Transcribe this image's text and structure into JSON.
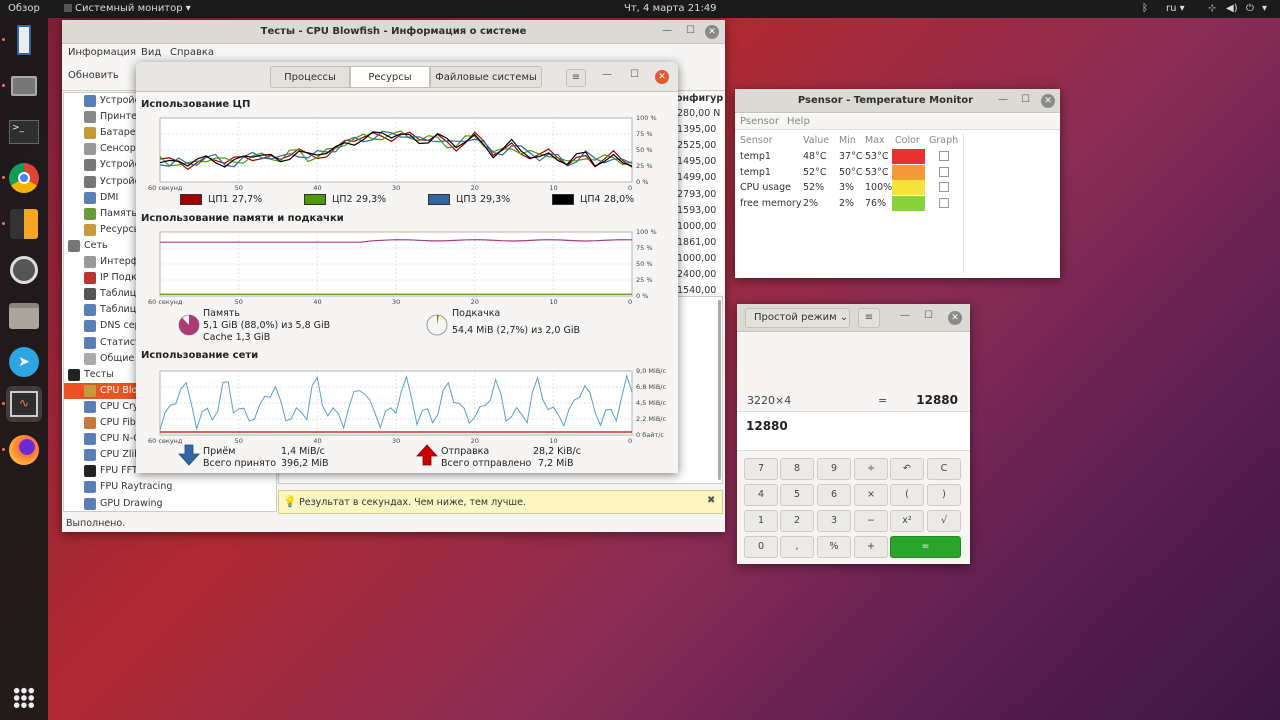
{
  "topbar": {
    "overview": "Обзор",
    "app_menu": "Системный монитор",
    "clock": "Чт, 4 марта  21:49",
    "lang": "ru"
  },
  "hardinfo": {
    "title": "Тесты - CPU Blowfish - Информация о системе",
    "menu": [
      "Информация",
      "Вид",
      "Справка"
    ],
    "refresh": "Обновить",
    "column_header": "онфигур",
    "values": [
      "280,00 N",
      "1395,00",
      "2525,00",
      "1495,00",
      "1499,00",
      "2793,00",
      "1593,00",
      "1000,00",
      "1861,00",
      "1000,00",
      "2400,00",
      "1540,00"
    ],
    "tree": [
      {
        "label": "Устройс",
        "color": "#5a7fb5",
        "indent": 1
      },
      {
        "label": "Принтер",
        "color": "#888",
        "indent": 1
      },
      {
        "label": "Батарея",
        "color": "#c49a3a",
        "indent": 1
      },
      {
        "label": "Сенсоры",
        "color": "#999",
        "indent": 1
      },
      {
        "label": "Устройс",
        "color": "#777",
        "indent": 1
      },
      {
        "label": "Устройс",
        "color": "#777",
        "indent": 1
      },
      {
        "label": "DMI",
        "color": "#5a7fb5",
        "indent": 1
      },
      {
        "label": "Память",
        "color": "#6a9a3a",
        "indent": 1
      },
      {
        "label": "Ресурсы",
        "color": "#c49a3a",
        "indent": 1
      },
      {
        "label": "Сеть",
        "color": "#777",
        "indent": 0
      },
      {
        "label": "Интерф",
        "color": "#999",
        "indent": 1
      },
      {
        "label": "IP Подк",
        "color": "#b33",
        "indent": 1
      },
      {
        "label": "Таблица",
        "color": "#555",
        "indent": 1
      },
      {
        "label": "Таблица",
        "color": "#5a7fb5",
        "indent": 1
      },
      {
        "label": "DNS сер",
        "color": "#5a7fb5",
        "indent": 1
      },
      {
        "label": "Статист",
        "color": "#5a7fb5",
        "indent": 1
      },
      {
        "label": "Общие п",
        "color": "#aaa",
        "indent": 1
      },
      {
        "label": "Тесты",
        "color": "#222",
        "indent": 0
      },
      {
        "label": "CPU Blow",
        "color": "#c49a3a",
        "indent": 1,
        "selected": true
      },
      {
        "label": "CPU Cry",
        "color": "#5a7fb5",
        "indent": 1
      },
      {
        "label": "CPU Fibo",
        "color": "#c47a3a",
        "indent": 1
      },
      {
        "label": "CPU N-Q",
        "color": "#5a7fb5",
        "indent": 1
      },
      {
        "label": "CPU Zlib",
        "color": "#5a7fb5",
        "indent": 1
      },
      {
        "label": "FPU FFT",
        "color": "#222",
        "indent": 1
      },
      {
        "label": "FPU Raytracing",
        "color": "#5a7fb5",
        "indent": 1
      },
      {
        "label": "GPU Drawing",
        "color": "#5a7fb5",
        "indent": 1
      }
    ],
    "hint": "Результат в секундах. Чем ниже, тем лучше.",
    "status": "Выполнено."
  },
  "sysmon": {
    "tabs": [
      "Процессы",
      "Ресурсы",
      "Файловые системы"
    ],
    "cpu_title": "Использование ЦП",
    "mem_title": "Использование памяти и подкачки",
    "net_title": "Использование сети",
    "x_ticks": [
      "60 секунд",
      "50",
      "40",
      "30",
      "20",
      "10",
      "0"
    ],
    "pct_ticks": [
      "100 %",
      "75 %",
      "50 %",
      "25 %",
      "0 %"
    ],
    "net_ticks": [
      "9,0 MiB/c",
      "6,8 MiB/c",
      "4,5 MiB/c",
      "2,2 MiB/c",
      "0 байт/с"
    ],
    "cpu_legend": [
      {
        "label": "ЦП1",
        "value": "27,7%",
        "color": "#a40000"
      },
      {
        "label": "ЦП2",
        "value": "29,3%",
        "color": "#4e9a06"
      },
      {
        "label": "ЦП3",
        "value": "29,3%",
        "color": "#3465a4"
      },
      {
        "label": "ЦП4",
        "value": "28,0%",
        "color": "#000000"
      }
    ],
    "memory": {
      "label": "Память",
      "line1": "5,1 GiB (88,0%) из 5,8 GiB",
      "line2": "Cache 1,3 GiB",
      "color": "#ad3c76",
      "fraction": 0.88
    },
    "swap": {
      "label": "Подкачка",
      "line1": "54,4 MiB (2,7%) из 2,0 GiB",
      "color": "#4e9a06",
      "fraction": 0.027
    },
    "net_rx": {
      "label": "Приём",
      "total_label": "Всего принято",
      "rate": "1,4 MiB/c",
      "total": "396,2 MiB",
      "color": "#3465a4"
    },
    "net_tx": {
      "label": "Отправка",
      "total_label": "Всего отправлено",
      "rate": "28,2 KiB/c",
      "total": "7,2 MiB",
      "color": "#cc0000"
    }
  },
  "psensor": {
    "title": "Psensor - Temperature Monitor",
    "menu": [
      "Psensor",
      "Help"
    ],
    "headers": [
      "Sensor",
      "Value",
      "Min",
      "Max",
      "Color",
      "Graph"
    ],
    "rows": [
      {
        "sensor": "temp1",
        "value": "48°C",
        "min": "37°C",
        "max": "53°C",
        "color": "#e8322e"
      },
      {
        "sensor": "temp1",
        "value": "52°C",
        "min": "50°C",
        "max": "53°C",
        "color": "#f59a3a"
      },
      {
        "sensor": "CPU usage",
        "value": "52%",
        "min": "3%",
        "max": "100%",
        "color": "#f5e23a"
      },
      {
        "sensor": "free memory",
        "value": "2%",
        "min": "2%",
        "max": "76%",
        "color": "#8ad43a"
      }
    ]
  },
  "calc": {
    "mode": "Простой режим",
    "expr": "3220×4",
    "eq": "=",
    "result": "12880",
    "entry": "12880",
    "keys": [
      [
        "7",
        "8",
        "9",
        "÷",
        "↶",
        "C"
      ],
      [
        "4",
        "5",
        "6",
        "×",
        "(",
        ")"
      ],
      [
        "1",
        "2",
        "3",
        "−",
        "x²",
        "√"
      ],
      [
        "0",
        ",",
        "%",
        "+",
        "="
      ]
    ]
  }
}
